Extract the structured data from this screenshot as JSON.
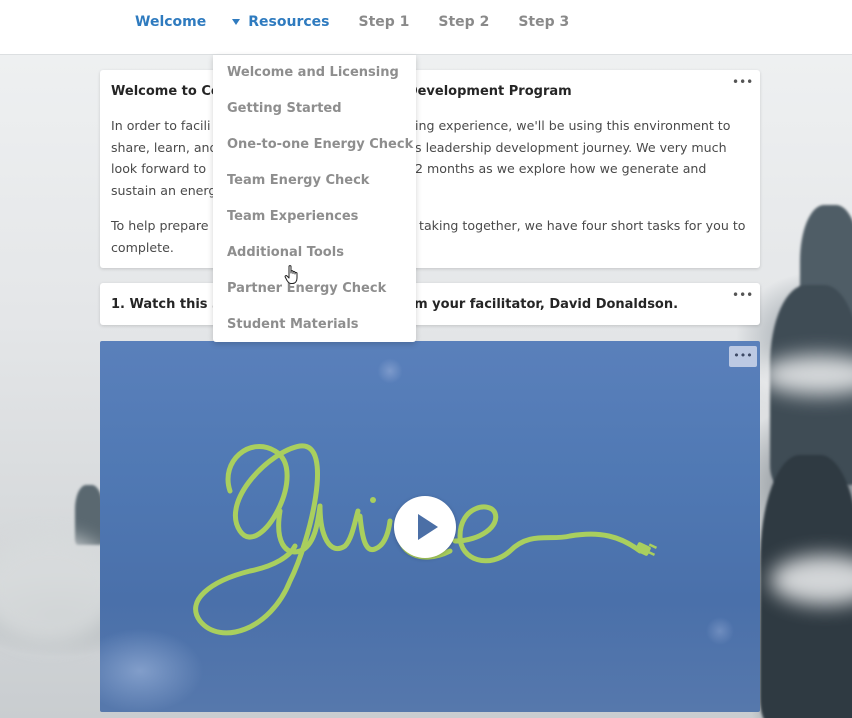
{
  "nav": {
    "items": [
      {
        "label": "Welcome",
        "active": true
      },
      {
        "label": "Resources",
        "active": true,
        "expanded": true
      },
      {
        "label": "Step 1",
        "active": false
      },
      {
        "label": "Step 2",
        "active": false
      },
      {
        "label": "Step 3",
        "active": false
      }
    ]
  },
  "dropdown": {
    "items": [
      "Welcome and Licensing",
      "Getting Started",
      "One-to-one Energy Check",
      "Team Energy Check",
      "Team Experiences",
      "Additional Tools",
      "Partner Energy Check",
      "Student Materials"
    ],
    "hovered": "Additional Tools"
  },
  "intro_card": {
    "title_left": "Welcome to Co",
    "title_right": "Development Program",
    "p1_left": [
      "In order to facili",
      "share, learn, and",
      "look forward to",
      "sustain an energ"
    ],
    "p1_right": [
      "ing experience, we'll be using this environment to",
      "s leadership development journey. We very much",
      "2 months as we explore how we generate and",
      ""
    ],
    "p2_left": [
      "To help prepare",
      "complete."
    ],
    "p2_right": [
      "taking together, we have four short tasks for you to",
      ""
    ],
    "more_label": "•••"
  },
  "task_card": {
    "title_left": "1. Watch this 3",
    "title_right": "m your facilitator, David Donaldson.",
    "more_label": "•••"
  },
  "video": {
    "title_art": "Juice",
    "more_label": "•••",
    "play_icon": "play-icon",
    "colors": {
      "background": "#5079b4",
      "lettering": "#a9cf5e"
    }
  }
}
